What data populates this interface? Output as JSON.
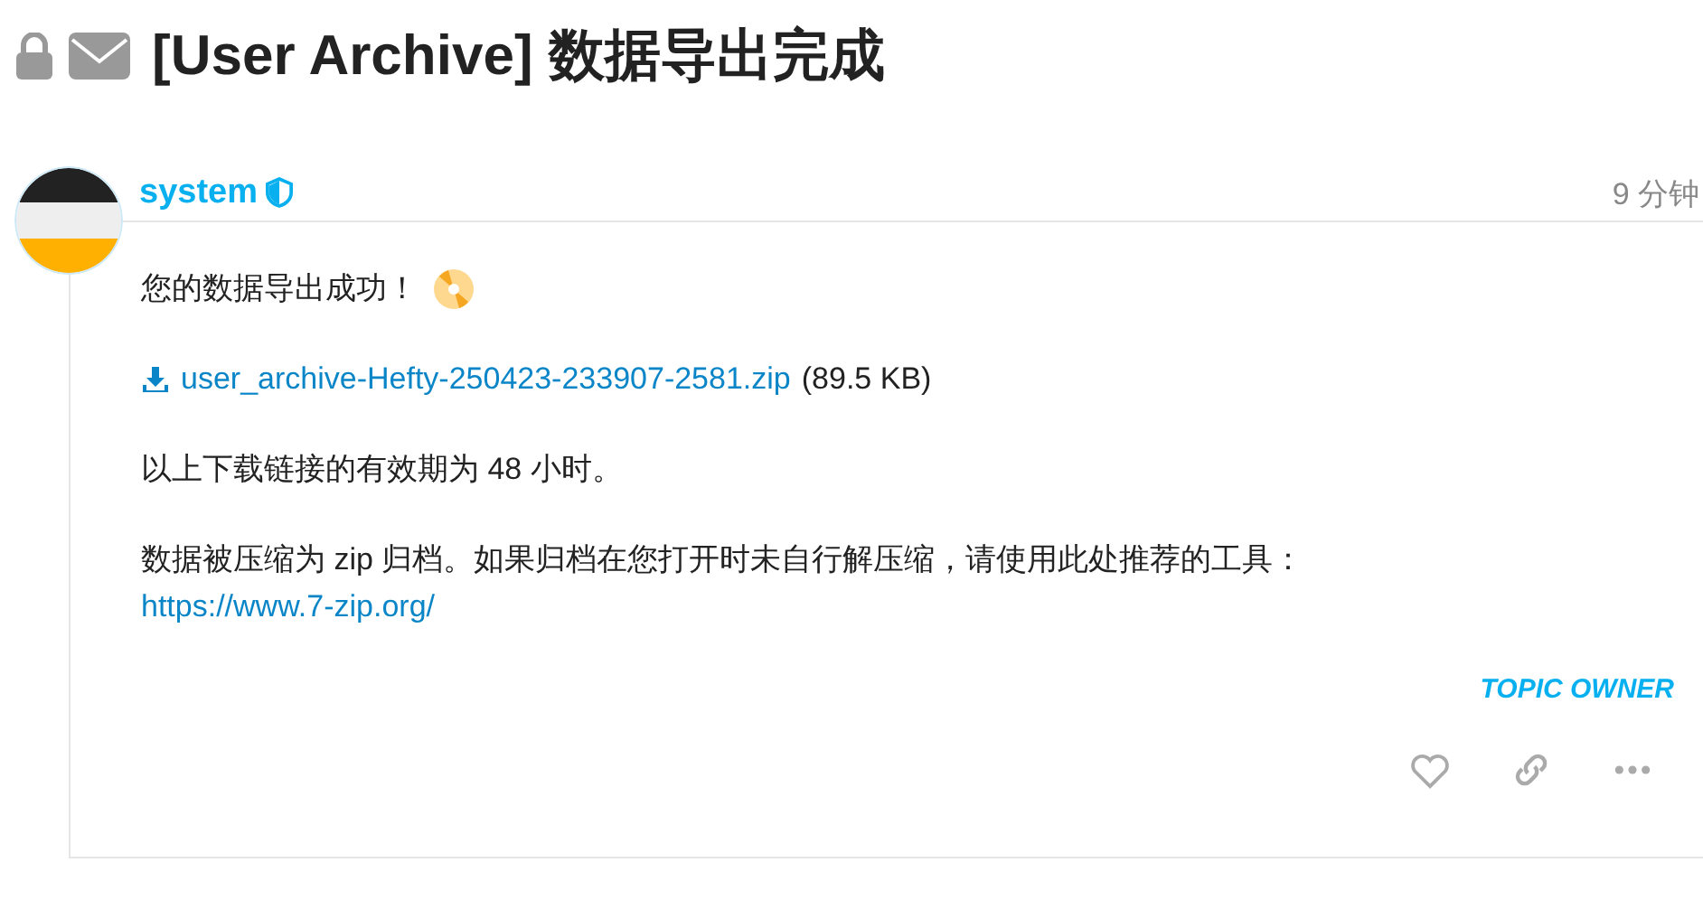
{
  "topic": {
    "title": "[User Archive] 数据导出完成",
    "closed": true,
    "private_message": true
  },
  "post": {
    "author": "system",
    "staff": true,
    "time": "9 分钟",
    "success": "您的数据导出成功！",
    "download": {
      "name": "user_archive-Hefty-250423-233907-2581.zip",
      "size": "(89.5 KB)"
    },
    "validity": "以上下载链接的有效期为 48 小时。",
    "note": "数据被压缩为 zip 归档。如果归档在您打开时未自行解压缩，请使用此处推荐的工具：",
    "tool_link": "https://www.7-zip.org/",
    "badge": "TOPIC OWNER"
  }
}
